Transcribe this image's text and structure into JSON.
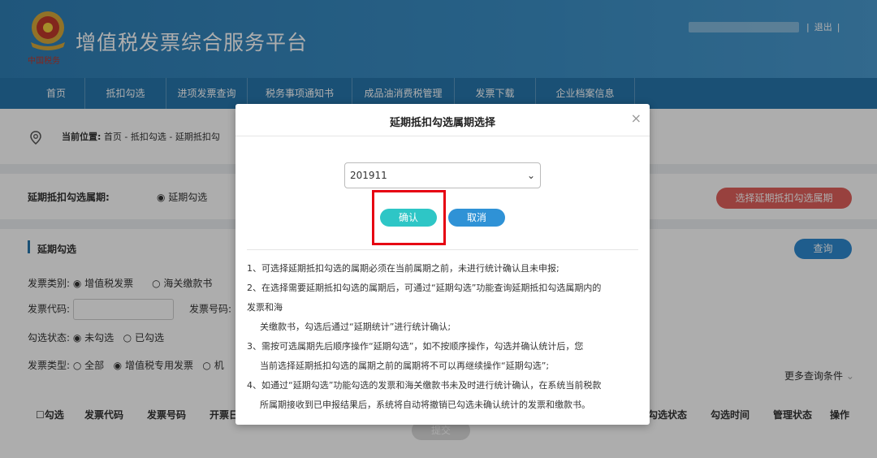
{
  "header": {
    "site_title": "增值税发票综合服务平台",
    "logout": "退出",
    "separator": "|",
    "brand_color": "#2f7fb6"
  },
  "nav": {
    "items": [
      {
        "label": "首页"
      },
      {
        "label": "抵扣勾选"
      },
      {
        "label": "进项发票查询"
      },
      {
        "label": "税务事项通知书"
      },
      {
        "label": "成品油消费税管理"
      },
      {
        "label": "发票下载"
      },
      {
        "label": "企业档案信息"
      }
    ]
  },
  "breadcrumb": {
    "prefix": "当前位置:",
    "path": "首页 - 抵扣勾选 - 延期抵扣勾"
  },
  "period": {
    "label": "延期抵扣勾选属期:",
    "radio_label": "延期勾选",
    "select_button": "选择延期抵扣勾选属期"
  },
  "section": {
    "title": "延期勾选",
    "query_button": "查询"
  },
  "form": {
    "invoice_category_label": "发票类别:",
    "invoice_category_opt1": "增值税发票",
    "invoice_category_opt2": "海关缴款书",
    "invoice_code_label": "发票代码:",
    "invoice_number_label": "发票号码:",
    "check_status_label": "勾选状态:",
    "check_status_opt1": "未勾选",
    "check_status_opt2": "已勾选",
    "invoice_type_label": "发票类型:",
    "invoice_type_opt1": "全部",
    "invoice_type_opt2": "增值税专用发票",
    "invoice_type_opt3": "机",
    "more_conditions": "更多查询条件"
  },
  "table": {
    "columns": [
      "勾选",
      "发票代码",
      "发票号码",
      "开票日",
      "勾选状态",
      "勾选时间",
      "管理状态",
      "操作"
    ]
  },
  "submit_label": "提交",
  "modal": {
    "title": "延期抵扣勾选属期选择",
    "close": "×",
    "selected_period": "201911",
    "confirm": "确认",
    "cancel": "取消",
    "notes": [
      "1、可选择延期抵扣勾选的属期必须在当前属期之前，未进行统计确认且未申报;",
      "2、在选择需要延期抵扣勾选的属期后，可通过“延期勾选”功能查询延期抵扣勾选属期内的",
      "发票和海",
      "关缴款书，勾选后通过“延期统计”进行统计确认;",
      "3、需按可选属期先后顺序操作“延期勾选”，如不按顺序操作，勾选并确认统计后，您",
      "当前选择延期抵扣勾选的属期之前的属期将不可以再继续操作“延期勾选”;",
      "4、如通过“延期勾选”功能勾选的发票和海关缴款书未及时进行统计确认，在系统当前税款",
      "所属期接收到已申报结果后，系统将自动将撤销已勾选未确认统计的发票和缴款书。"
    ]
  },
  "colors": {
    "highlight": "#e60012",
    "confirm": "#2ec6c6",
    "cancel": "#2f92d6",
    "select_period_btn": "#e0605c"
  }
}
